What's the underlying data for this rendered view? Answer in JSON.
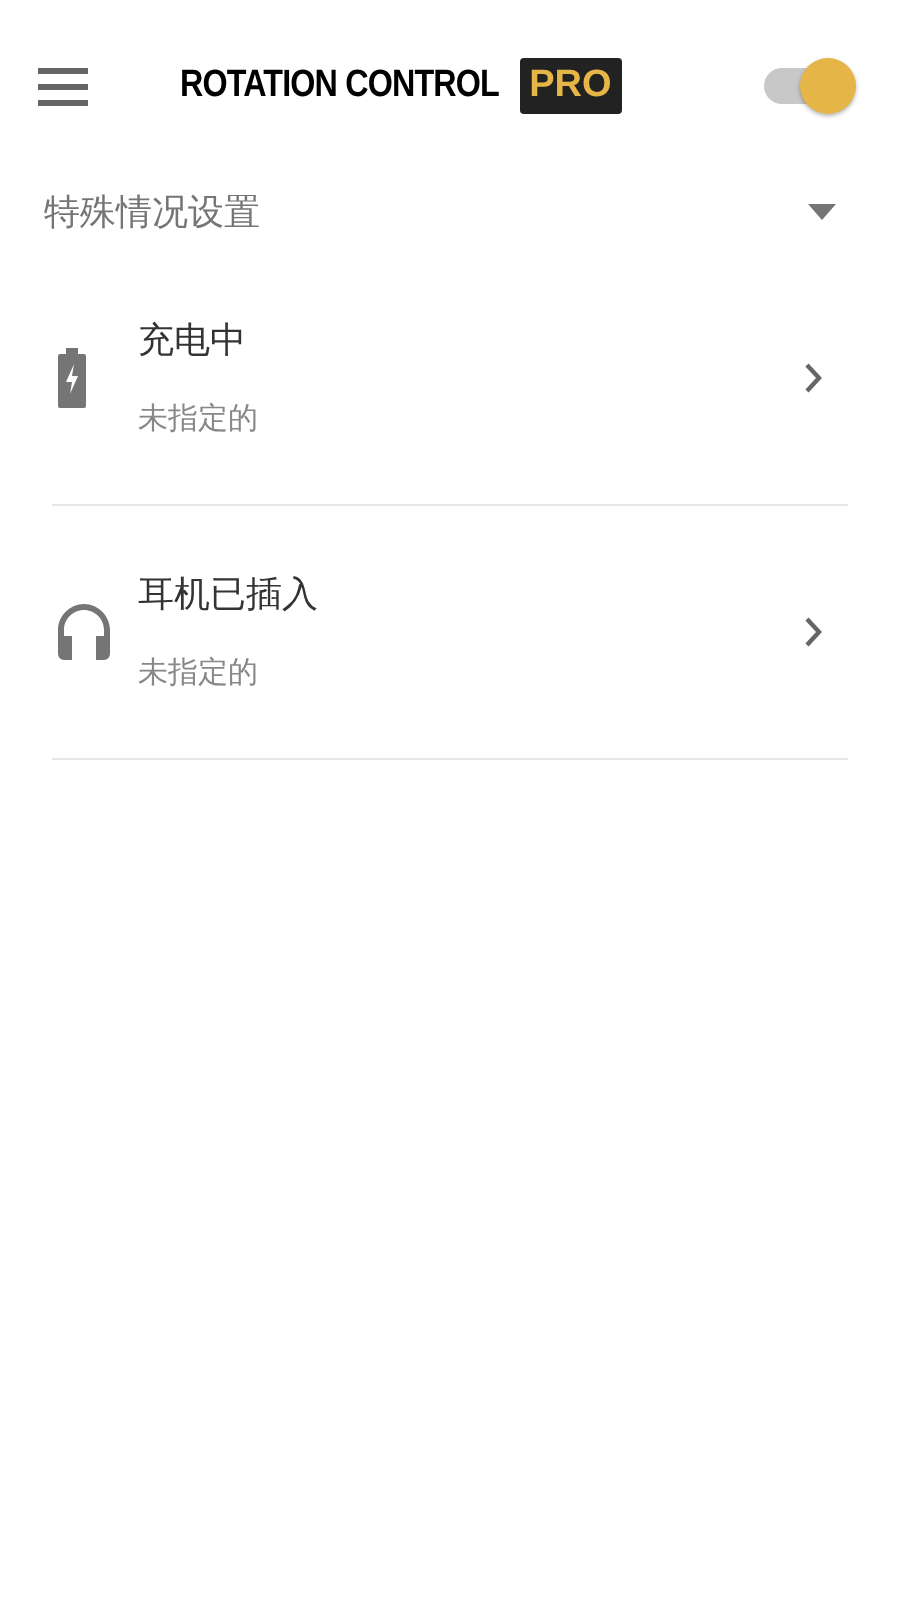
{
  "app_bar": {
    "logo_text": "ROTATION CONTROL",
    "logo_badge": "PRO",
    "master_switch": {
      "on": true
    }
  },
  "section": {
    "title": "特殊情况设置",
    "expanded": true
  },
  "items": [
    {
      "kind": "battery",
      "title": "充电中",
      "subtitle": "未指定的"
    },
    {
      "kind": "headphones",
      "title": "耳机已插入",
      "subtitle": "未指定的"
    }
  ]
}
